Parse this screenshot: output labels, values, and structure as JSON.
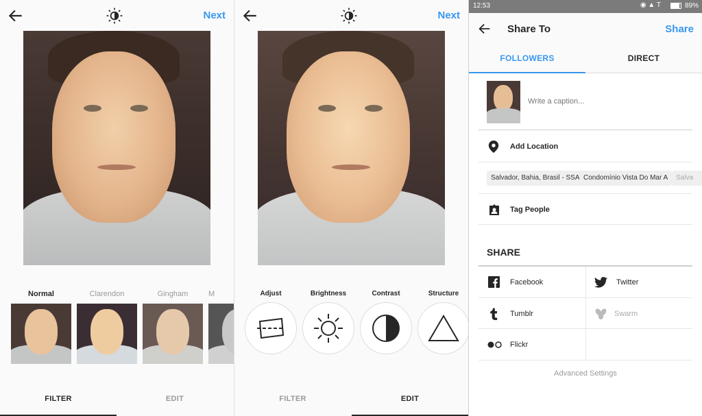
{
  "panel1": {
    "next_label": "Next",
    "filters": [
      {
        "name": "Normal",
        "selected": true
      },
      {
        "name": "Clarendon",
        "selected": false
      },
      {
        "name": "Gingham",
        "selected": false
      },
      {
        "name": "M",
        "selected": false
      }
    ],
    "tabs": [
      "FILTER",
      "EDIT"
    ],
    "active_tab": "FILTER"
  },
  "panel2": {
    "next_label": "Next",
    "tools": [
      {
        "name": "Adjust",
        "icon": "adjust-icon"
      },
      {
        "name": "Brightness",
        "icon": "brightness-icon"
      },
      {
        "name": "Contrast",
        "icon": "contrast-icon"
      },
      {
        "name": "Structure",
        "icon": "structure-icon"
      }
    ],
    "tabs": [
      "FILTER",
      "EDIT"
    ],
    "active_tab": "EDIT"
  },
  "panel3": {
    "status": {
      "time": "12:53",
      "battery": "89%"
    },
    "title": "Share To",
    "share_label": "Share",
    "tabs": [
      {
        "label": "FOLLOWERS"
      },
      {
        "label": "DIRECT"
      }
    ],
    "caption_placeholder": "Write a caption...",
    "add_location": "Add Location",
    "location_chips": [
      "Salvador, Bahia, Brasil - SSA",
      "Condomínio Vista Do Mar A",
      "Salva"
    ],
    "tag_people": "Tag People",
    "share_heading": "SHARE",
    "share_targets": [
      {
        "name": "Facebook",
        "icon": "facebook-icon",
        "enabled": true
      },
      {
        "name": "Twitter",
        "icon": "twitter-icon",
        "enabled": true
      },
      {
        "name": "Tumblr",
        "icon": "tumblr-icon",
        "enabled": true
      },
      {
        "name": "Swarm",
        "icon": "swarm-icon",
        "enabled": false
      },
      {
        "name": "Flickr",
        "icon": "flickr-icon",
        "enabled": true
      }
    ],
    "advanced_settings": "Advanced Settings"
  },
  "colors": {
    "accent": "#3897f0",
    "text": "#262626",
    "muted": "#999999"
  }
}
